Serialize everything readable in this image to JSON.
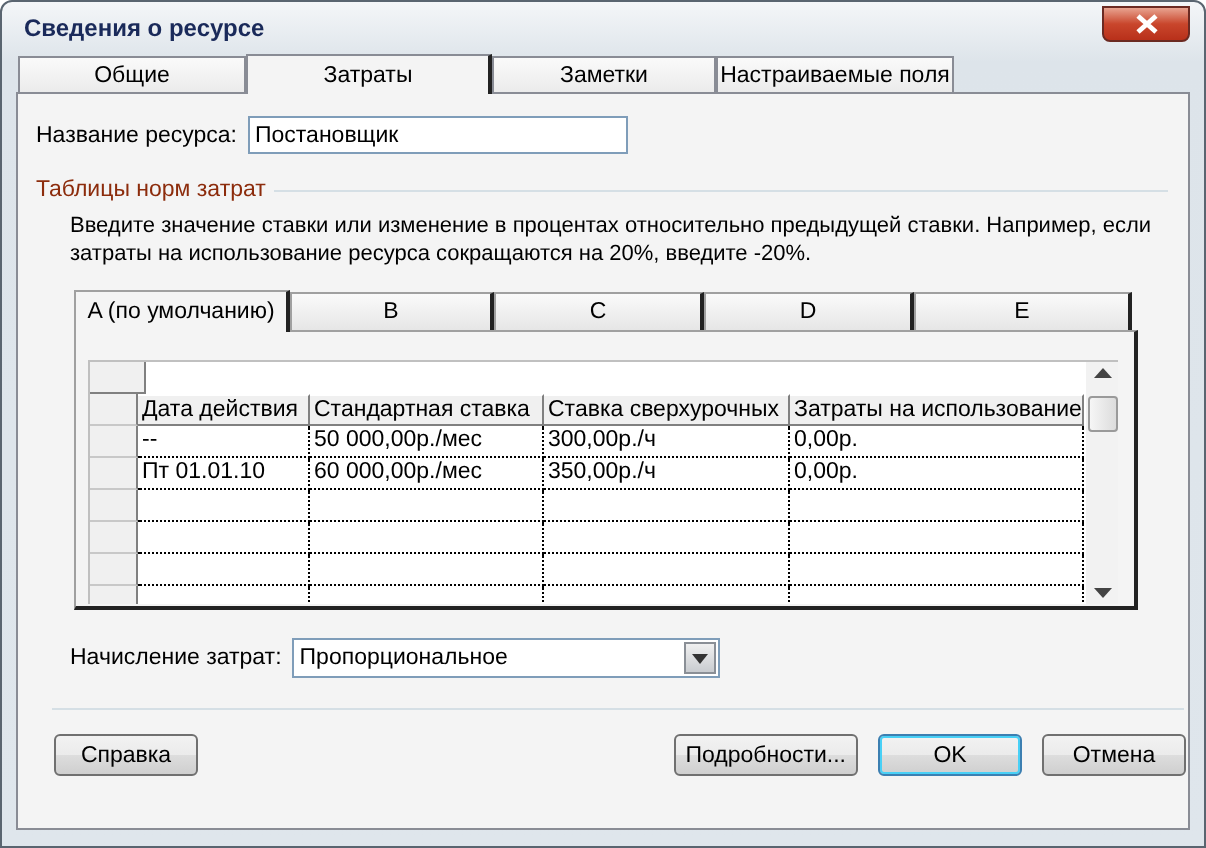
{
  "window": {
    "title": "Сведения о ресурсе"
  },
  "tabs": [
    {
      "label": "Общие",
      "selected": false
    },
    {
      "label": "Затраты",
      "selected": true
    },
    {
      "label": "Заметки",
      "selected": false
    },
    {
      "label": "Настраиваемые поля",
      "selected": false
    }
  ],
  "resource_name": {
    "label": "Название ресурса:",
    "value": "Постановщик"
  },
  "rate_tables": {
    "title": "Таблицы норм затрат",
    "hint": "Введите значение ставки или изменение в процентах относительно предыдущей ставки. Например, если затраты на использование ресурса сокращаются на 20%, введите -20%.",
    "tabs": [
      {
        "label": "A (по умолчанию)",
        "selected": true
      },
      {
        "label": "B",
        "selected": false
      },
      {
        "label": "C",
        "selected": false
      },
      {
        "label": "D",
        "selected": false
      },
      {
        "label": "E",
        "selected": false
      }
    ],
    "table": {
      "columns": [
        "Дата действия",
        "Стандартная ставка",
        "Ставка сверхурочных",
        "Затраты на использование"
      ],
      "rows": [
        [
          "--",
          "50 000,00р./мес",
          "300,00р./ч",
          "0,00р."
        ],
        [
          "Пт 01.01.10",
          "60 000,00р./мес",
          "350,00р./ч",
          "0,00р."
        ]
      ]
    }
  },
  "accrual": {
    "label": "Начисление затрат:",
    "value": "Пропорциональное"
  },
  "buttons": [
    {
      "label": "Справка",
      "default": false
    },
    {
      "label": "Подробности...",
      "default": false
    },
    {
      "label": "OK",
      "default": true
    },
    {
      "label": "Отмена",
      "default": false
    }
  ]
}
